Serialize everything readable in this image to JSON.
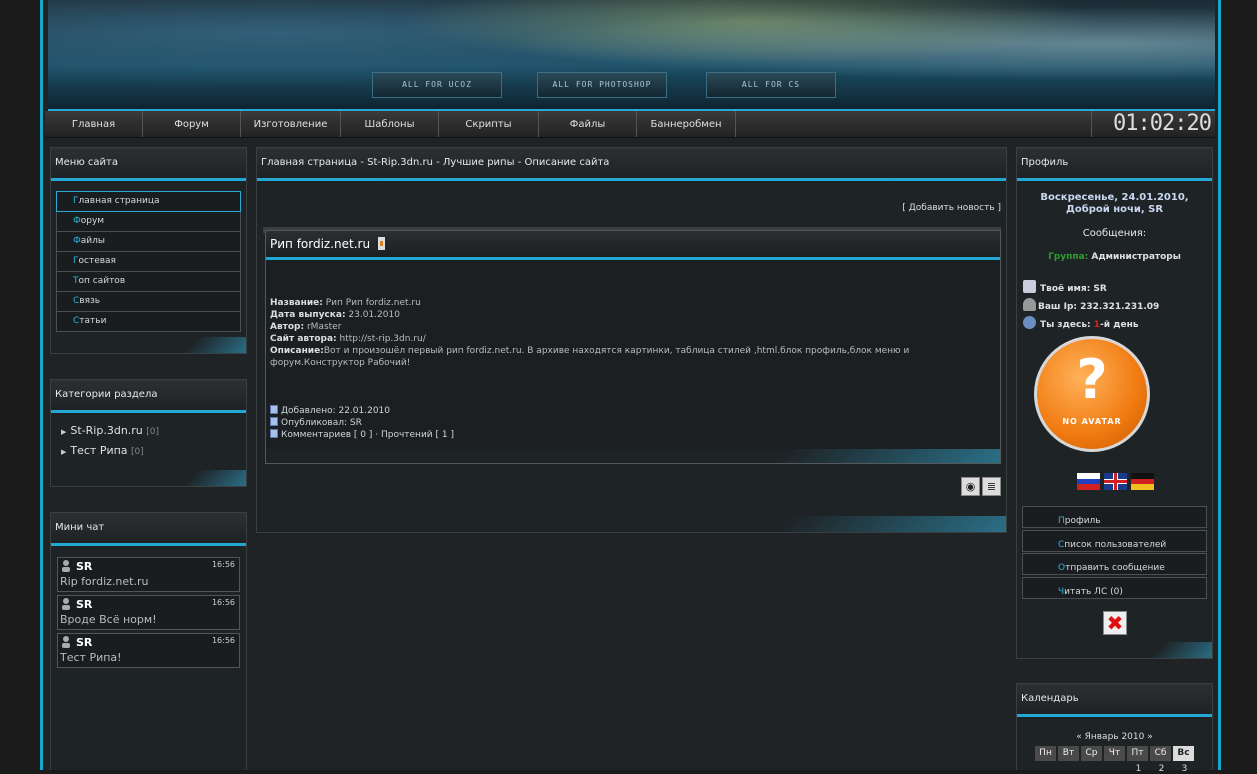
{
  "header": {
    "buttons": [
      "ALL FOR UCOZ",
      "ALL FOR PHOTOSHOP",
      "ALL FOR CS"
    ]
  },
  "nav": {
    "items": [
      "Главная",
      "Форум",
      "Изготовление",
      "Шаблоны",
      "Скрипты",
      "Файлы",
      "Баннеробмен"
    ],
    "clock": "01:02:20"
  },
  "site_menu": {
    "title": "Меню сайта",
    "items": [
      {
        "first": "Г",
        "rest": "лавная страница"
      },
      {
        "first": "Ф",
        "rest": "орум"
      },
      {
        "first": "Ф",
        "rest": "айлы"
      },
      {
        "first": "Г",
        "rest": "остевая"
      },
      {
        "first": "Т",
        "rest": "оп сайтов"
      },
      {
        "first": "С",
        "rest": "вязь"
      },
      {
        "first": "С",
        "rest": "татьи"
      }
    ]
  },
  "categories": {
    "title": "Категории раздела",
    "items": [
      {
        "label": "St-Rip.3dn.ru",
        "count": "[0]"
      },
      {
        "label": "Тест Рипа",
        "count": "[0]"
      }
    ]
  },
  "mini_chat": {
    "title": "Мини чат",
    "messages": [
      {
        "user": "SR",
        "time": "16:56",
        "text": "Rip fordiz.net.ru"
      },
      {
        "user": "SR",
        "time": "16:56",
        "text": "Вроде Всё норм!"
      },
      {
        "user": "SR",
        "time": "16:56",
        "text": "Тест Рипа!"
      }
    ]
  },
  "main": {
    "breadcrumb": "Главная страница - St-Rip.3dn.ru - Лучшие рипы - Описание сайта",
    "add_news": "[ Добавить новость ]",
    "news": {
      "title": "Рип fordiz.net.ru",
      "fields": [
        {
          "label": "Название:",
          "value": " Рип Рип fordiz.net.ru"
        },
        {
          "label": "Дата выпуска:",
          "value": " 23.01.2010"
        },
        {
          "label": "Автор:",
          "value": " rMaster"
        },
        {
          "label": "Сайт автора:",
          "value": " http://st-rip.3dn.ru/"
        },
        {
          "label": "Описание:",
          "value": "Вот и произошёл первый рип fordiz.net.ru. В архиве находятся картинки, таблица стилей ,html.блок профиль,блок меню и форум.Конструктор Рабочий!"
        }
      ],
      "added": "Добавлено: 22.01.2010",
      "published": "Опубликовал: SR",
      "stats": "Комментариев [ 0 ] · Прочтений [ 1 ]"
    }
  },
  "profile": {
    "title": "Профиль",
    "date": "Воскресенье, 24.01.2010,",
    "greeting": "Доброй ночи, SR",
    "messages": "Сообщения:",
    "group_label": "Группа:",
    "group_value": "Администраторы",
    "name_line": "Твоё имя: SR",
    "ip_line": "Ваш Ip: 232.321.231.09",
    "here_prefix": "Ты здесь: ",
    "here_num": "1",
    "here_suffix": "-й день",
    "avatar_text": "NO AVATAR",
    "buttons": [
      {
        "first": "П",
        "rest": "рофиль"
      },
      {
        "first": "С",
        "rest": "писок пользователей"
      },
      {
        "first": "О",
        "rest": "тправить сообщение"
      },
      {
        "first": "Ч",
        "rest": "итать ЛС (0)"
      }
    ]
  },
  "calendar": {
    "title": "Календарь",
    "month": "« Январь 2010 »",
    "days": [
      "Пн",
      "Вт",
      "Ср",
      "Чт",
      "Пт",
      "Сб",
      "Вс"
    ],
    "first_row": [
      "1",
      "2",
      "3"
    ]
  },
  "colors": {
    "accent": "#22a9d3",
    "group": "#2e9e2e",
    "day_red": "#e02020"
  }
}
